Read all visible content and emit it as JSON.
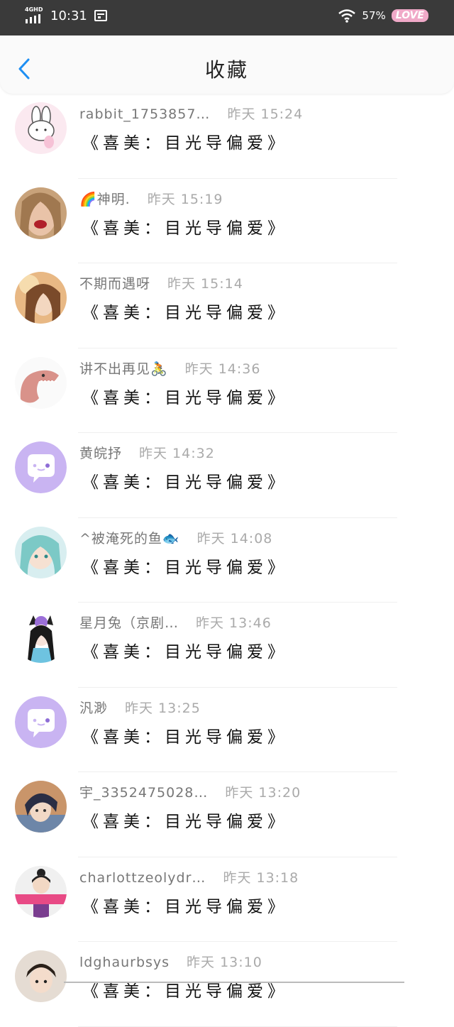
{
  "status": {
    "network": "4GHD",
    "time": "10:31",
    "battery": "57%",
    "badge": "LOVE"
  },
  "header": {
    "title": "收藏"
  },
  "items": [
    {
      "name": "rabbit_1753857…",
      "time": "昨天 15:24",
      "text": "《喜美：目光导偏爱》",
      "avatar": "rabbit"
    },
    {
      "name": "🌈神明.",
      "time": "昨天 15:19",
      "text": "《喜美：目光导偏爱》",
      "avatar": "girl-red"
    },
    {
      "name": "不期而遇呀",
      "time": "昨天 15:14",
      "text": "《喜美：目光导偏爱》",
      "avatar": "girl-warm"
    },
    {
      "name": "讲不出再见🚴",
      "time": "昨天 14:36",
      "text": "《喜美：目光导偏爱》",
      "avatar": "dinosaur"
    },
    {
      "name": "黄皖抒",
      "time": "昨天 14:32",
      "text": "《喜美：目光导偏爱》",
      "avatar": "default"
    },
    {
      "name": "^被淹死的鱼🐟",
      "time": "昨天 14:08",
      "text": "《喜美：目光导偏爱》",
      "avatar": "miku"
    },
    {
      "name": "星月兔（京剧…",
      "time": "昨天 13:46",
      "text": "《喜美：目光导偏爱》",
      "avatar": "cat-girl"
    },
    {
      "name": "汎渺",
      "time": "昨天 13:25",
      "text": "《喜美：目光导偏爱》",
      "avatar": "default"
    },
    {
      "name": "宇_3352475028…",
      "time": "昨天 13:20",
      "text": "《喜美：目光导偏爱》",
      "avatar": "anime-boy"
    },
    {
      "name": "charlottzeolydr…",
      "time": "昨天 13:18",
      "text": "《喜美：目光导偏爱》",
      "avatar": "kid-sign"
    },
    {
      "name": "ldghaurbsys",
      "time": "昨天 13:10",
      "text": "《喜美：目光导偏爱》",
      "avatar": "kid"
    }
  ]
}
